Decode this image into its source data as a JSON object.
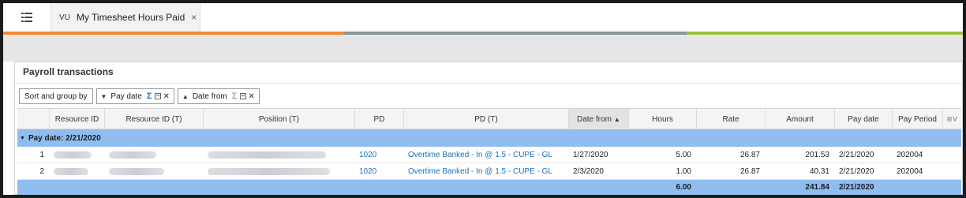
{
  "tab": {
    "badge": "VU",
    "title": "My Timesheet Hours Paid",
    "close_icon": "×",
    "menu_icon": "list-icon"
  },
  "stripes": {
    "orange": "#f28a30",
    "grey": "#8a9298",
    "green": "#9cc23a"
  },
  "panel": {
    "title": "Payroll transactions"
  },
  "sort": {
    "button_label": "Sort and group by",
    "chips": [
      {
        "label": "Pay date",
        "direction": "desc",
        "summed": true
      },
      {
        "label": "Date from",
        "direction": "asc",
        "summed": false
      }
    ]
  },
  "columns": {
    "resource_id": "Resource ID",
    "resource_id_t": "Resource ID (T)",
    "position_t": "Position (T)",
    "pd": "PD",
    "pd_t": "PD (T)",
    "date_from": "Date from",
    "hours": "Hours",
    "rate": "Rate",
    "amount": "Amount",
    "pay_date": "Pay date",
    "pay_period": "Pay Period"
  },
  "group": {
    "label": "Pay date: 2/21/2020"
  },
  "rows": [
    {
      "num": "1",
      "pd": "1020",
      "pd_t": "Overtime Banked - In @ 1.5 - CUPE - GL",
      "date_from": "1/27/2020",
      "hours": "5.00",
      "rate": "26.87",
      "amount": "201.53",
      "pay_date": "2/21/2020",
      "pay_period": "202004"
    },
    {
      "num": "2",
      "pd": "1020",
      "pd_t": "Overtime Banked - In @ 1.5 - CUPE - GL",
      "date_from": "2/3/2020",
      "hours": "1.00",
      "rate": "26.87",
      "amount": "40.31",
      "pay_date": "2/21/2020",
      "pay_period": "202004"
    }
  ],
  "totals": {
    "hours": "6.00",
    "amount": "241.84",
    "pay_date": "2/21/2020"
  },
  "colors": {
    "group_band": "#8fbdf0",
    "link": "#1a6fbf",
    "sigma": "#1a73c9"
  }
}
